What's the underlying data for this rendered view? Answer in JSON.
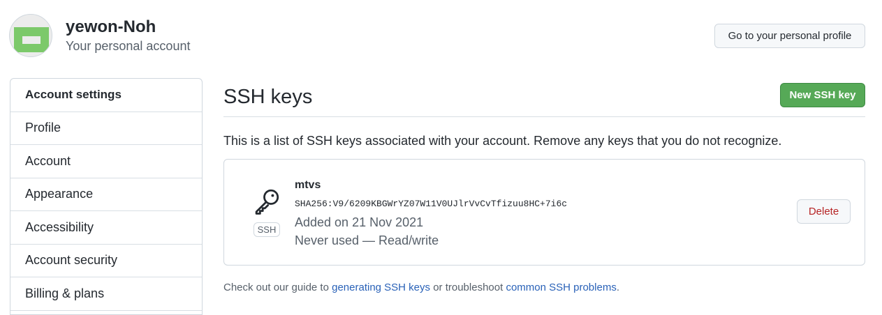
{
  "header": {
    "username": "yewon-Noh",
    "subtitle": "Your personal account",
    "profile_button": "Go to your personal profile"
  },
  "sidebar": {
    "heading": "Account settings",
    "items": [
      {
        "label": "Profile"
      },
      {
        "label": "Account"
      },
      {
        "label": "Appearance"
      },
      {
        "label": "Accessibility"
      },
      {
        "label": "Account security"
      },
      {
        "label": "Billing & plans"
      }
    ]
  },
  "main": {
    "title": "SSH keys",
    "new_button": "New SSH key",
    "description": "This is a list of SSH keys associated with your account. Remove any keys that you do not recognize.",
    "key": {
      "badge": "SSH",
      "name": "mtvs",
      "fingerprint": "SHA256:V9/6209KBGWrYZ07W11V0UJlrVvCvTfizuu8HC+7i6c",
      "added": "Added on 21 Nov 2021",
      "usage": "Never used — Read/write",
      "delete_button": "Delete"
    },
    "footer": {
      "prefix": "Check out our guide to ",
      "link1": "generating SSH keys",
      "middle": " or troubleshoot ",
      "link2": "common SSH problems",
      "suffix": "."
    }
  },
  "colors": {
    "primary_button": "#56a957",
    "danger_text": "#b62324",
    "link": "#2a62b8"
  },
  "icons": {
    "key": "key-icon"
  }
}
